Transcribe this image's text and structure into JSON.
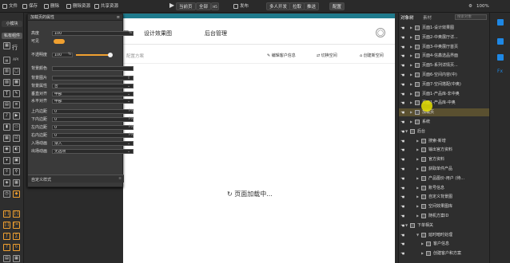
{
  "toolbar": {
    "file": "文件",
    "save": "保存",
    "delete": "删除",
    "delete_resource": "删除资源",
    "share_resource": "共享资源",
    "preview_page": "当前页",
    "all": "全部",
    "publish": "发布",
    "multi_dev": "多人开发",
    "checkout": "拉取",
    "checkin": "推送",
    "config": "配置",
    "zoom": "100%"
  },
  "leftbar": {
    "tab_small": "小模块",
    "tab_widgets": "私有组件",
    "row": "行"
  },
  "prop_panel": {
    "title": "加载页的属性",
    "rows": [
      {
        "label": "高度",
        "value": "100",
        "unit": "%"
      },
      {
        "label": "可见",
        "toggle": "on"
      },
      {
        "label": "不透明度",
        "value": "100",
        "unit": "%"
      },
      {
        "label": "背景颜色",
        "value": ""
      },
      {
        "label": "背景图片",
        "value": ""
      },
      {
        "label": "背景属性",
        "value": "否"
      },
      {
        "label": "垂直对齐",
        "value": "中部"
      },
      {
        "label": "水平对齐",
        "value": "中部"
      },
      {
        "label": "上内边距",
        "value": "0",
        "unit": "PX"
      },
      {
        "label": "下内边距",
        "value": "0",
        "unit": "PX"
      },
      {
        "label": "左内边距",
        "value": "0",
        "unit": "PX"
      },
      {
        "label": "右内边距",
        "value": "0",
        "unit": "PX"
      },
      {
        "label": "入场动画",
        "value": "渐入"
      },
      {
        "label": "出场动画",
        "value": "无选项"
      }
    ],
    "custom_style": "自定义样式"
  },
  "canvas": {
    "nav_tab_partial": "厅",
    "nav_design": "设计效果图",
    "nav_admin": "后台管理",
    "sub_config": "配置方案",
    "action_edit_customer": "编辑客户信息",
    "action_switch_space": "切换空间",
    "action_create_space": "创建新空间",
    "loading_text": "页面加载中..."
  },
  "right_panel": {
    "tab_objects": "对象树",
    "tab_assets": "素材",
    "search_placeholder": "搜索对象",
    "tree": [
      {
        "label": "页面1-设计效果图",
        "indent": 0
      },
      {
        "label": "页面2-中奥展厅详...",
        "indent": 0
      },
      {
        "label": "页面3-中奥展厅首页",
        "indent": 0
      },
      {
        "label": "页面4-信鑫选品界面",
        "indent": 0
      },
      {
        "label": "页面5-系列详情页...",
        "indent": 0
      },
      {
        "label": "页面6-空间内容(中)",
        "indent": 0
      },
      {
        "label": "页面7-空间搭配(中奥)",
        "indent": 0
      },
      {
        "label": "页面1-产品库-非中奥",
        "indent": 0
      },
      {
        "label": "页面1-产品库-中奥",
        "indent": 0
      },
      {
        "label": "加载页",
        "indent": 0,
        "selected": true
      },
      {
        "label": "系统",
        "indent": 0
      },
      {
        "label": "后台",
        "indent": -1
      },
      {
        "label": "搜索-新增",
        "indent": 1
      },
      {
        "label": "输出官方资料",
        "indent": 1
      },
      {
        "label": "官方资料",
        "indent": 1
      },
      {
        "label": "获取单件产品",
        "indent": 1
      },
      {
        "label": "产品图价-用户 (待...",
        "indent": 1
      },
      {
        "label": "账号信息",
        "indent": 1
      },
      {
        "label": "自定义背景图",
        "indent": 1
      },
      {
        "label": "空间效果图库",
        "indent": 1
      },
      {
        "label": "随机方案ID",
        "indent": 1
      },
      {
        "label": "下单相关",
        "indent": -1
      },
      {
        "label": "延时暗时处理",
        "indent": 2
      },
      {
        "label": "客户信息",
        "indent": 3
      },
      {
        "label": "创建客户和方案",
        "indent": 3
      }
    ]
  },
  "colors": {
    "accent": "#f0a030",
    "highlight": "#e6e000"
  }
}
